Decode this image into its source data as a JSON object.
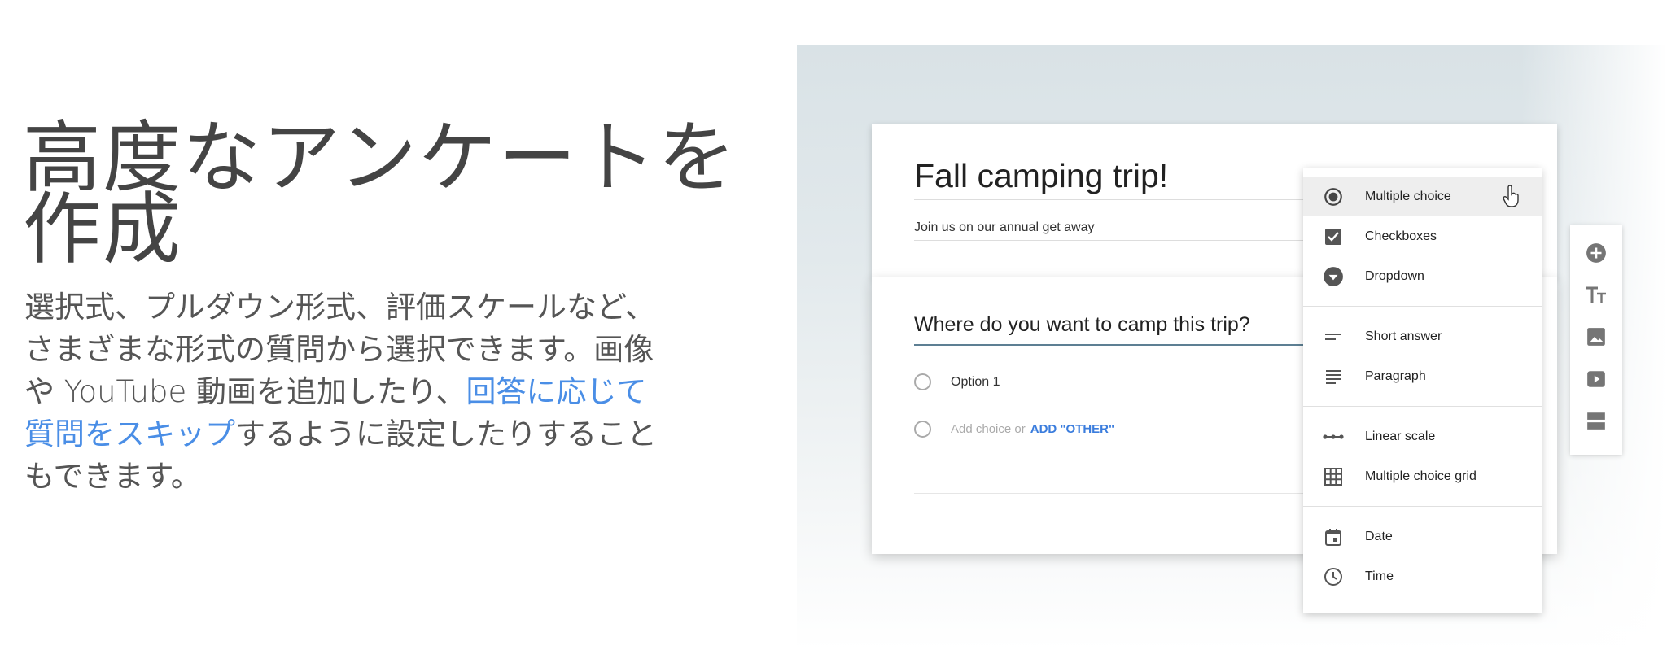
{
  "hero": {
    "title": "高度なアンケートを作成",
    "desc_part1": "選択式、プルダウン形式、評価スケールなど、さまざまな形式の質問から選択できます。画像や YouTube 動画を追加したり、",
    "desc_link": "回答に応じて質問をスキップ",
    "desc_part2": "するように設定したりすることもできます。"
  },
  "form": {
    "title": "Fall camping trip!",
    "description": "Join us on our annual get away"
  },
  "question": {
    "title": "Where do you want to camp this trip?",
    "option1": "Option 1",
    "add_choice": "Add choice or",
    "add_other": "ADD \"OTHER\""
  },
  "type_menu": {
    "items": [
      {
        "label": "Multiple choice",
        "icon": "radio-checked-icon",
        "selected": true
      },
      {
        "label": "Checkboxes",
        "icon": "checkbox-icon"
      },
      {
        "label": "Dropdown",
        "icon": "dropdown-icon"
      },
      {
        "label": "Short answer",
        "icon": "short-text-icon"
      },
      {
        "label": "Paragraph",
        "icon": "paragraph-icon"
      },
      {
        "label": "Linear scale",
        "icon": "linear-scale-icon"
      },
      {
        "label": "Multiple choice grid",
        "icon": "grid-icon"
      },
      {
        "label": "Date",
        "icon": "calendar-icon"
      },
      {
        "label": "Time",
        "icon": "clock-icon"
      }
    ]
  },
  "toolbar": {
    "icons": [
      "add-question-icon",
      "title-text-icon",
      "image-icon",
      "video-icon",
      "section-icon"
    ]
  },
  "colors": {
    "link": "#4a8ee6",
    "add_other": "#3b7ddd",
    "icon": "#616161",
    "underline": "#5d7f93"
  }
}
